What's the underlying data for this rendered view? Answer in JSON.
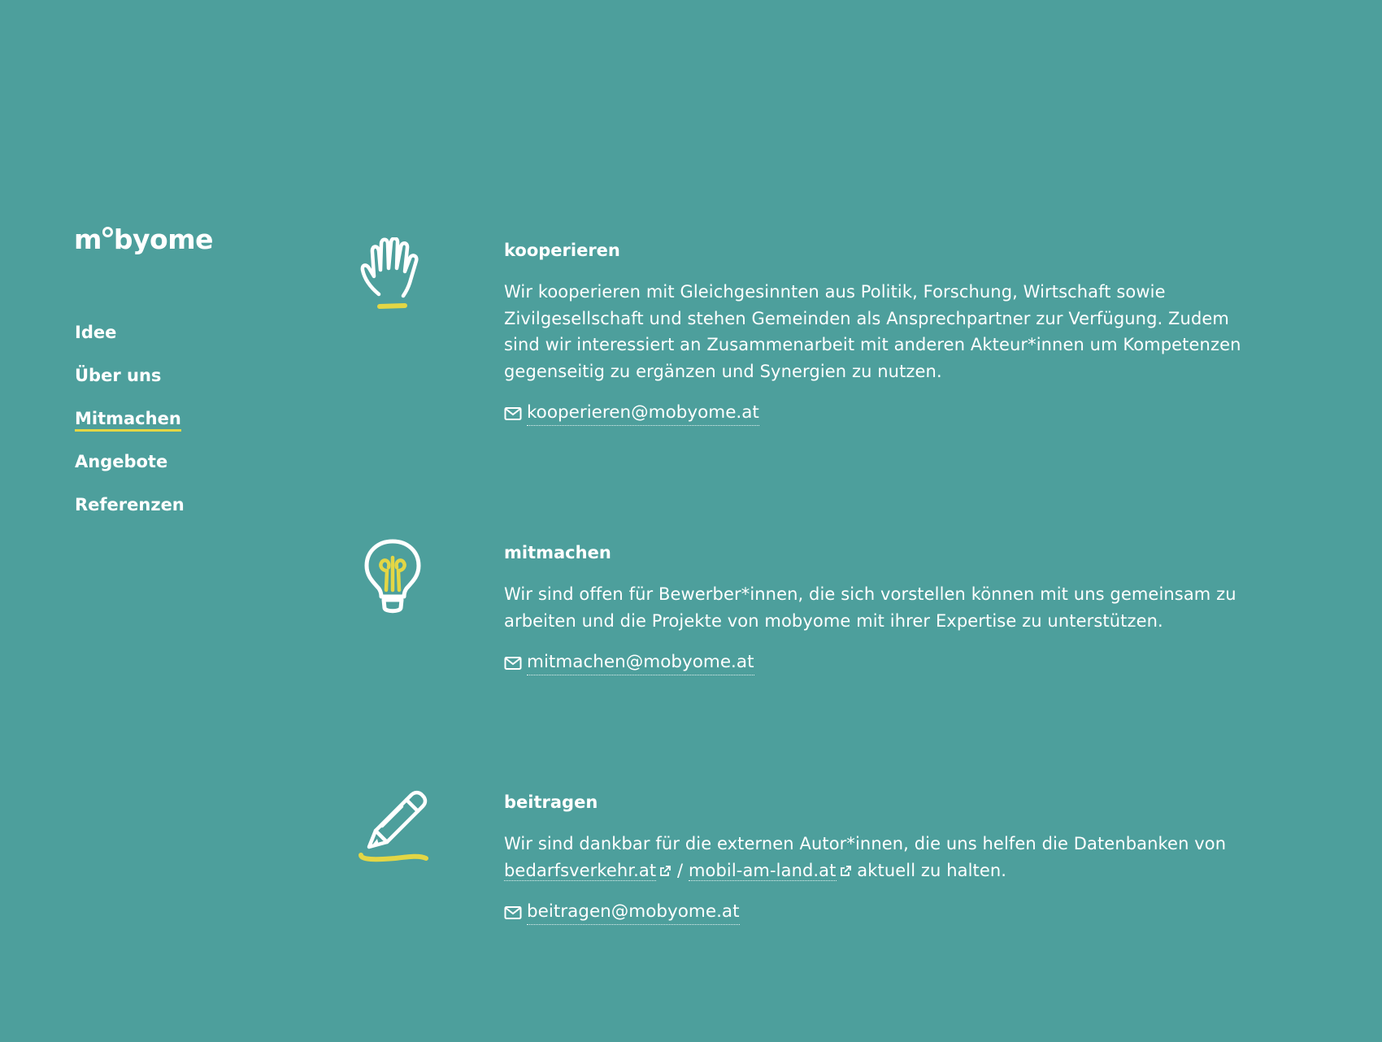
{
  "brand": {
    "logo_m": "m",
    "logo_rest": "byome"
  },
  "nav": {
    "items": [
      {
        "label": "Idee"
      },
      {
        "label": "Über uns"
      },
      {
        "label": "Mitmachen"
      },
      {
        "label": "Angebote"
      },
      {
        "label": "Referenzen"
      }
    ],
    "active": "Mitmachen"
  },
  "sections": [
    {
      "icon": "hand-icon",
      "title": "kooperieren",
      "text": "Wir kooperieren mit Gleichgesinnten aus Politik, Forschung, Wirtschaft sowie Zivilgesellschaft und stehen Gemeinden als Ansprechpartner zur Verfügung. Zudem sind wir interessiert an Zusammenarbeit mit anderen Akteur*innen um Kompetenzen gegenseitig zu ergänzen und Synergien zu nutzen.",
      "email": "kooperieren@mobyome.at"
    },
    {
      "icon": "lightbulb-icon",
      "title": "mitmachen",
      "text": "Wir sind offen für Bewerber*innen, die sich vorstellen können mit uns gemeinsam zu arbeiten und die Projekte von mobyome mit ihrer Expertise zu unterstützen.",
      "email": "mitmachen@mobyome.at"
    },
    {
      "icon": "pencil-icon",
      "title": "beitragen",
      "text_before": "Wir sind dankbar für die externen Autor*innen, die uns helfen die Datenbanken von",
      "link1": "bedarfsverkehr.at",
      "separator": "/",
      "link2": "mobil-am-land.at",
      "text_after": "aktuell zu halten.",
      "email": "beitragen@mobyome.at"
    }
  ],
  "colors": {
    "background": "#4d9f9c",
    "text": "#ffffff",
    "accent": "#e3d645"
  }
}
